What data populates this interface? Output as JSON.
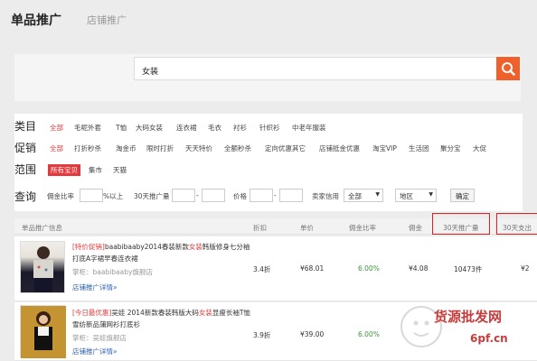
{
  "tabs": {
    "main": "单品推广",
    "secondary": "店铺推广"
  },
  "search": {
    "value": "女装"
  },
  "filters": {
    "category": {
      "label": "类目",
      "options": [
        "全部",
        "毛呢外套",
        "T恤",
        "大码女装",
        "连衣裙",
        "毛衣",
        "衬衫",
        "针织衫",
        "中老年服装"
      ],
      "selected": "全部"
    },
    "promo": {
      "label": "促销",
      "options": [
        "全部",
        "打折秒杀",
        "淘金币",
        "限时打折",
        "天天特价",
        "全额秒杀",
        "定向优惠其它",
        "店铺抵金优惠",
        "淘宝VIP",
        "生活团",
        "聚分宝",
        "大促"
      ],
      "selected": "全部"
    },
    "scope": {
      "label": "范围",
      "options": [
        "所有宝贝",
        "集市",
        "天猫"
      ],
      "selected": "所有宝贝"
    },
    "query": {
      "label": "查询",
      "commission_label": "佣金比率",
      "pct_suffix": "%以上",
      "promo30_label": "30天推广量",
      "dash": "-",
      "price_label": "价格",
      "seller_label": "卖家信用",
      "seller_select": "全部",
      "region_select": "地区",
      "confirm": "确定"
    }
  },
  "table": {
    "headers": [
      "单品推广信息",
      "折扣",
      "单价",
      "佣金比率",
      "佣金",
      "30天推广量",
      "30天支出"
    ],
    "rows": [
      {
        "tag": "[特价促销]",
        "title_pre": "baabibaaby2014春装新款",
        "title_hl": "女装",
        "title_post": "韩版修身七分袖打底A字裙早春连衣裙",
        "seller": "掌柜：baabibaaby旗舰店",
        "link": "店铺推广详情»",
        "discount": "3.4折",
        "price": "¥68.01",
        "rate": "6.00%",
        "commission": "¥4.08",
        "promo30": "10473件",
        "spend30": "¥2"
      },
      {
        "tag": "[今日最优惠]",
        "title_pre": "吴娃 2014新款春装韩版大码",
        "title_hl": "女装",
        "title_post": "显瘦长袖T恤雪纺新品蒲网衫打底衫",
        "seller": "掌柜：吴娃旗舰店",
        "link": "店铺推广详情»",
        "discount": "3.9折",
        "price": "¥39.00",
        "rate": "6.00%",
        "commission": "",
        "promo30": "",
        "spend30": ""
      }
    ]
  },
  "watermark": {
    "line1": "货源批发网",
    "line2": "6pf.cn"
  },
  "colors": {
    "accent": "#e4393c",
    "search_btn": "#f0602a",
    "highlight_box": "#e02020",
    "green": "#3a9a3a"
  }
}
